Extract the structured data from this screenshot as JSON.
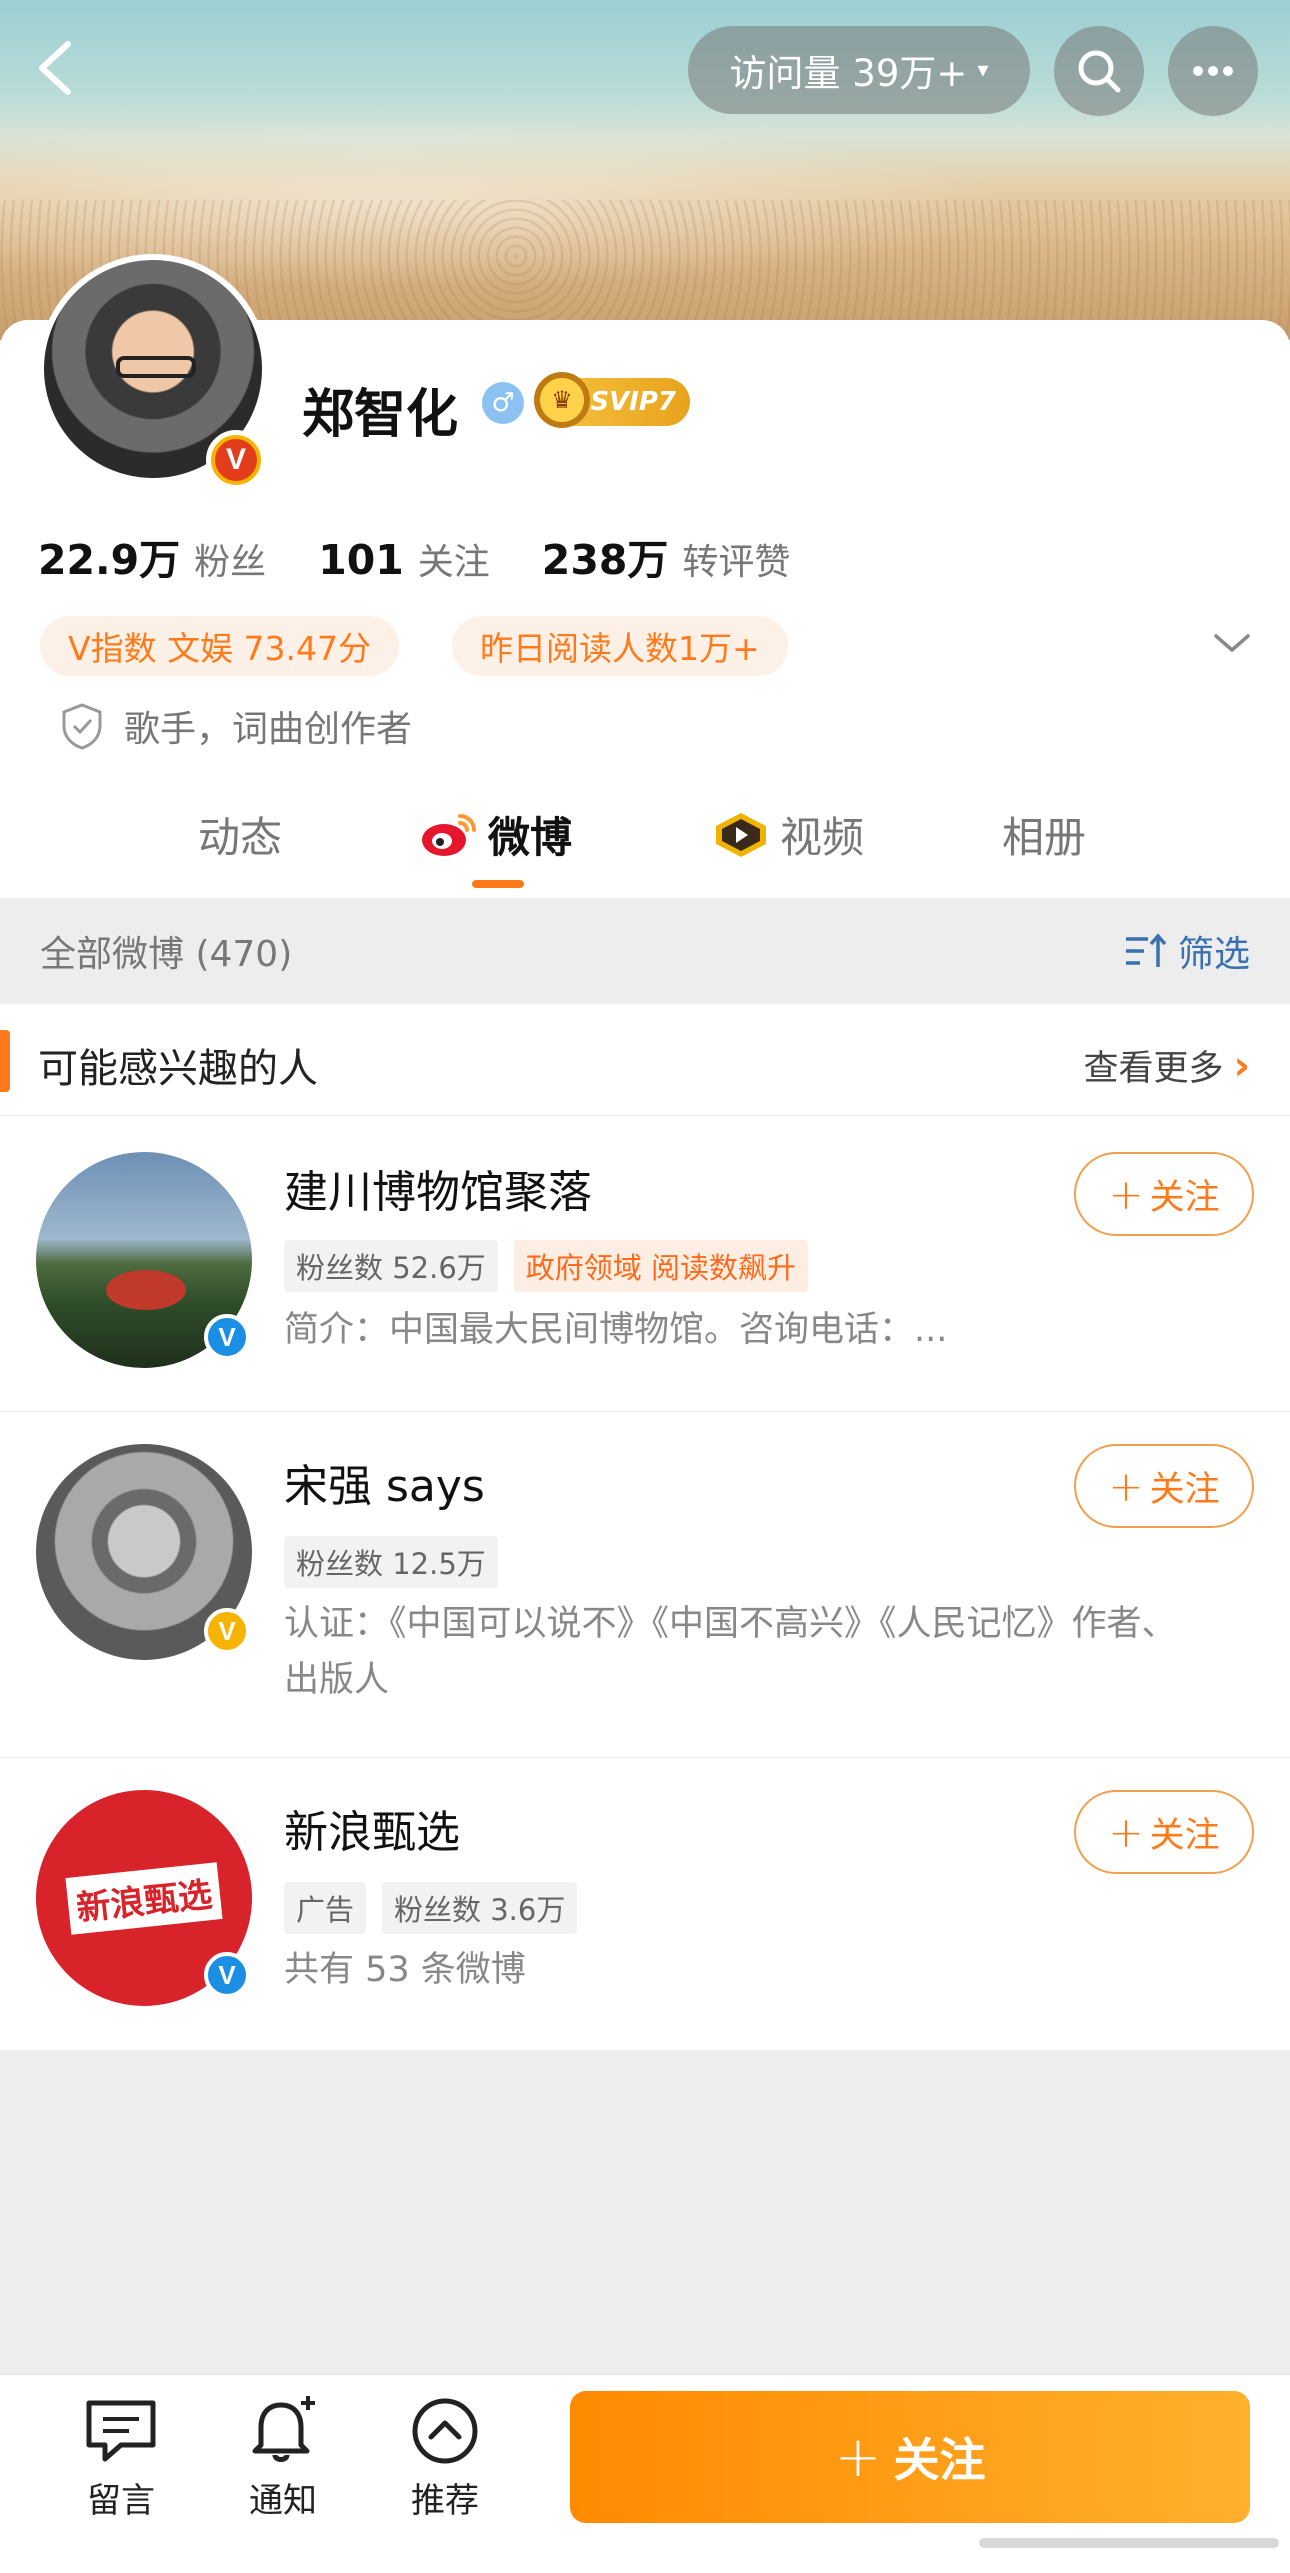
{
  "header": {
    "visits_label": "访问量 39万+",
    "visits_caret": "▾"
  },
  "profile": {
    "name": "郑智化",
    "gender_symbol": "♂",
    "vip_label": "SVIP7",
    "verified_badge_letter": "V",
    "stats": [
      {
        "num": "22.9万",
        "label": "粉丝"
      },
      {
        "num": "101",
        "label": "关注"
      },
      {
        "num": "238万",
        "label": "转评赞"
      }
    ],
    "tags": [
      "V指数 文娱 73.47分",
      "昨日阅读人数1万+"
    ],
    "verification": "歌手，词曲创作者"
  },
  "tabs": [
    {
      "label": "动态",
      "icon": "none"
    },
    {
      "label": "微博",
      "icon": "weibo-logo-icon",
      "active": true
    },
    {
      "label": "视频",
      "icon": "video-play-icon"
    },
    {
      "label": "相册",
      "icon": "none"
    }
  ],
  "filter_bar": {
    "count_label": "全部微博 (470)",
    "filter_label": "筛选"
  },
  "recommendations": {
    "title": "可能感兴趣的人",
    "more_label": "查看更多",
    "people": [
      {
        "name": "建川博物馆聚落",
        "tags": [
          "粉丝数 52.6万",
          "政府领域 阅读数飙升"
        ],
        "desc": "简介：中国最大民间博物馆。咨询电话：...",
        "badge": "blue",
        "follow": "关注"
      },
      {
        "name": "宋强 says",
        "tags": [
          "粉丝数 12.5万"
        ],
        "desc": "认证：《中国可以说不》《中国不高兴》《人民记忆》作者、出版人",
        "badge": "yellow",
        "follow": "关注"
      },
      {
        "name": "新浪甄选",
        "tags": [
          "广告",
          "粉丝数 3.6万"
        ],
        "desc": "共有 53 条微博",
        "badge": "blue",
        "follow": "关注",
        "avatar_text": "新浪甄选"
      }
    ]
  },
  "bottom_bar": {
    "items": [
      {
        "label": "留言",
        "icon": "message-icon"
      },
      {
        "label": "通知",
        "icon": "bell-plus-icon"
      },
      {
        "label": "推荐",
        "icon": "recommend-up-icon"
      }
    ],
    "follow_label": "关注"
  },
  "colors": {
    "accent": "#ff7a1a",
    "link_blue": "#3a6fb0",
    "verified_blue": "#1a8fe3",
    "verified_yellow": "#f6b400"
  }
}
